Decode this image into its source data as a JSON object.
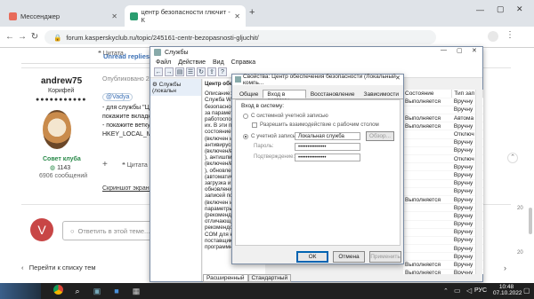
{
  "browser": {
    "tabs": [
      {
        "label": "Мессенджер",
        "active": false
      },
      {
        "label": "центр безопасности глючит - К",
        "active": true
      }
    ],
    "url": "forum.kasperskyclub.ru/topic/245161-centr-bezopasnosti-gljuchit/"
  },
  "forum": {
    "citation_top": "Цитата",
    "unread_replies": "Unread replies",
    "user": {
      "name": "andrew75",
      "rank": "Корифей",
      "group": "Совет клуба",
      "points": "1143",
      "posts": "6906 сообщений"
    },
    "post": {
      "published": "Опубликовано 21",
      "mention": "@Vadya",
      "lines": [
        "- для службы \"Ц",
        "покажите вкладк",
        "- покажите ветку",
        "HKEY_LOCAL_MA"
      ],
      "citation": "Цитата",
      "screenshot_link": "Скриншот экрана"
    },
    "reply_avatar": "V",
    "reply_placeholder": "Ответить в этой теме...",
    "back_link": "Перейти к списку тем",
    "right_counts": [
      "20",
      "20"
    ]
  },
  "services_window": {
    "title": "Службы",
    "menu": [
      "Файл",
      "Действие",
      "Вид",
      "Справка"
    ],
    "tree_item": "Службы (локальн",
    "pane_header": "Центр обеспеч",
    "description_label": "Описание:",
    "description": [
      "Служба WSC",
      "безопасност",
      "за параметр",
      "работоспос",
      "их. В эти па",
      "состояние б",
      "(включен и",
      "антивирусн",
      "(включен/вы",
      "), антишпио",
      "(включен/вы",
      "), обновлен",
      "(автоматиче",
      "загрузка и у",
      "обновлений",
      "записей пол",
      "(включен ил",
      "параметры б",
      "(рекомендо",
      "отличающие",
      "рекомендов",
      "COM для не",
      "поставщиков программных"
    ],
    "bottom_tabs": [
      "Расширенный",
      "Стандартный"
    ],
    "columns": [
      "Состояние",
      "Тип зап"
    ],
    "rows": [
      [
        "Выполняется",
        "Вручну"
      ],
      [
        "",
        "Вручну"
      ],
      [
        "Выполняется",
        "Автома"
      ],
      [
        "Выполняется",
        "Вручну"
      ],
      [
        "",
        "Отключ"
      ],
      [
        "",
        "Вручну"
      ],
      [
        "",
        "Вручну"
      ],
      [
        "",
        "Отключ"
      ],
      [
        "",
        "Вручну"
      ],
      [
        "",
        "Вручну"
      ],
      [
        "",
        "Вручну"
      ],
      [
        "",
        "Вручну"
      ],
      [
        "Выполняется",
        "Вручну"
      ],
      [
        "",
        "Вручну"
      ],
      [
        "",
        "Вручну"
      ],
      [
        "",
        "Вручну"
      ],
      [
        "",
        "Вручну"
      ],
      [
        "",
        "Вручну"
      ],
      [
        "",
        "Вручну"
      ],
      [
        "",
        "Вручну"
      ],
      [
        "Выполняется",
        "Вручну"
      ],
      [
        "Выполняется",
        "Вручну"
      ],
      [
        "",
        "Вручну"
      ],
      [
        "",
        "Вручну"
      ]
    ]
  },
  "dialog": {
    "title": "Свойства: Центр обеспечения безопасности (Локальный компь...",
    "tabs": [
      "Общие",
      "Вход в систему",
      "Восстановление",
      "Зависимости"
    ],
    "login_label": "Вход в систему:",
    "radio_system": "С системной учетной записью",
    "check_interact": "Разрешить взаимодействие с рабочим столом",
    "radio_account": "С учетной записью:",
    "account_value": "Локальная служба",
    "browse": "Обзор...",
    "password_label": "Пароль:",
    "password_value": "•••••••••••••••",
    "confirm_label": "Подтверждение:",
    "confirm_value": "•••••••••••••••",
    "ok": "ОК",
    "cancel": "Отмена",
    "apply": "Применить"
  },
  "taskbar": {
    "weather": "",
    "lang": "РУС",
    "time": "10:48",
    "date": "07.10.2022"
  }
}
